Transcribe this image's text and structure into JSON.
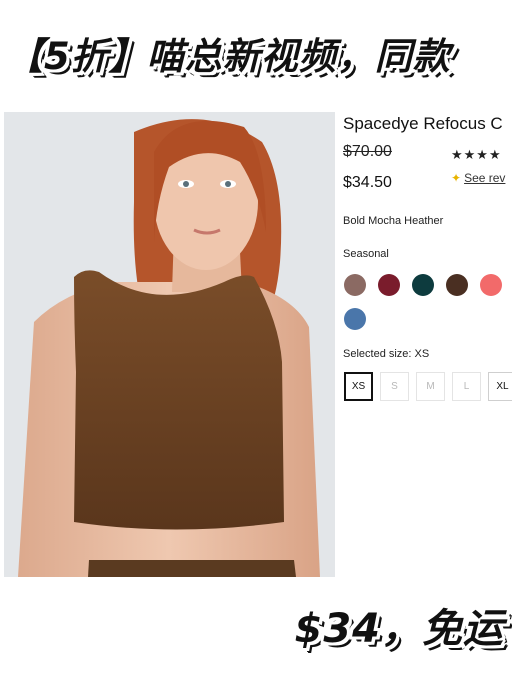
{
  "overlay": {
    "headline": "【5折】喵总新视频，同款",
    "footer_price": "$34，免运"
  },
  "product": {
    "title": "Spacedye Refocus C",
    "original_price": "$70.00",
    "sale_price": "$34.50",
    "stars": "★★★★",
    "reviews_link": "See rev",
    "color_name": "Bold Mocha Heather",
    "color_group_label": "Seasonal",
    "swatches": [
      {
        "name": "swatch-mauve",
        "color": "#8b6a63"
      },
      {
        "name": "swatch-burgundy",
        "color": "#7a1c2c"
      },
      {
        "name": "swatch-dark-teal",
        "color": "#0d3b3e"
      },
      {
        "name": "swatch-mocha",
        "color": "#4a2f22"
      },
      {
        "name": "swatch-coral",
        "color": "#f26a6a"
      },
      {
        "name": "swatch-blue",
        "color": "#4a76aa"
      }
    ],
    "selected_size_label": "Selected size: XS",
    "sizes": [
      "XS",
      "S",
      "M",
      "L",
      "XL"
    ]
  },
  "colors": {
    "top_brown": "#6b4324",
    "hair": "#b5552b",
    "skin": "#e9bfa5",
    "background": "#e3e6e9"
  }
}
